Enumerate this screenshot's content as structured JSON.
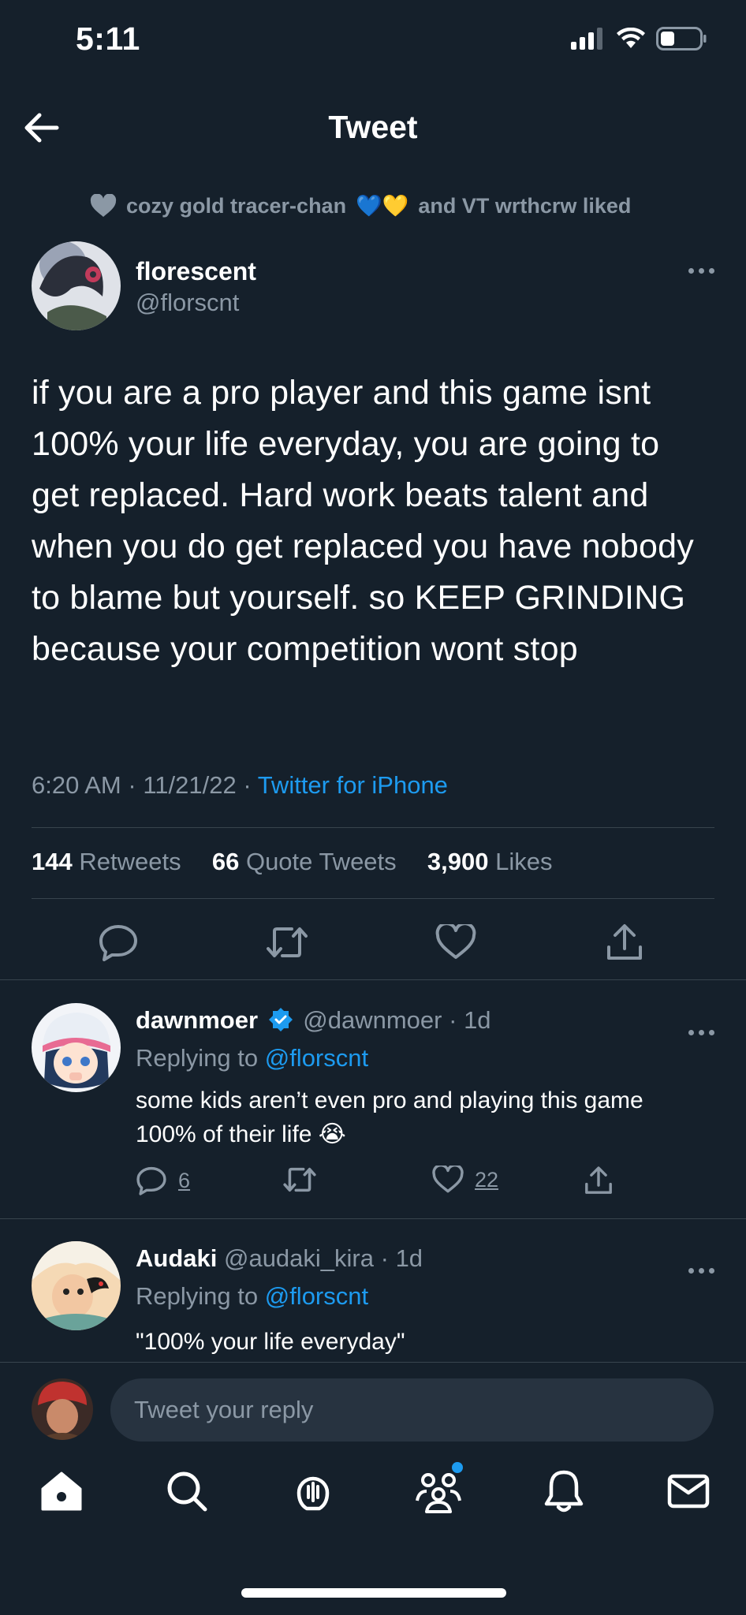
{
  "status_bar": {
    "time": "5:11"
  },
  "header": {
    "title": "Tweet"
  },
  "social_context": {
    "text_before": "cozy gold tracer-chan",
    "emoji": "💙💛",
    "text_after": "and VT wrthcrw liked"
  },
  "tweet": {
    "author_name": "florescent",
    "author_handle": "@florscnt",
    "text": "if you are a pro player and this game isnt 100% your life everyday, you are going to get replaced. Hard work beats talent and when you do get replaced you have nobody to blame but yourself. so KEEP GRINDING because your competition wont stop",
    "time": "6:20 AM",
    "date": "11/21/22",
    "source": "Twitter for iPhone",
    "retweets_count": "144",
    "retweets_label": "Retweets",
    "quotes_count": "66",
    "quotes_label": "Quote Tweets",
    "likes_count": "3,900",
    "likes_label": "Likes"
  },
  "replies": [
    {
      "name": "dawnmoer",
      "verified": true,
      "handle": "@dawnmoer",
      "time": "1d",
      "replying_label": "Replying to",
      "replying_to": "@florscnt",
      "text": "some kids aren’t even pro and playing this game 100% of their life 😭",
      "reply_count": "6",
      "retweet_count": "",
      "like_count": "22"
    },
    {
      "name": "Audaki",
      "verified": false,
      "handle": "@audaki_kira",
      "time": "1d",
      "replying_label": "Replying to",
      "replying_to": "@florscnt",
      "text": "\"100% your life everyday\""
    }
  ],
  "composer": {
    "placeholder": "Tweet your reply"
  },
  "icons": {
    "back": "back-arrow-icon",
    "tabs": [
      "home-icon",
      "search-icon",
      "spaces-icon",
      "communities-icon",
      "notifications-icon",
      "messages-icon"
    ]
  },
  "colors": {
    "background": "#15202b",
    "accent": "#1d9bf0",
    "muted": "#8b98a5",
    "divider": "#38444d"
  }
}
